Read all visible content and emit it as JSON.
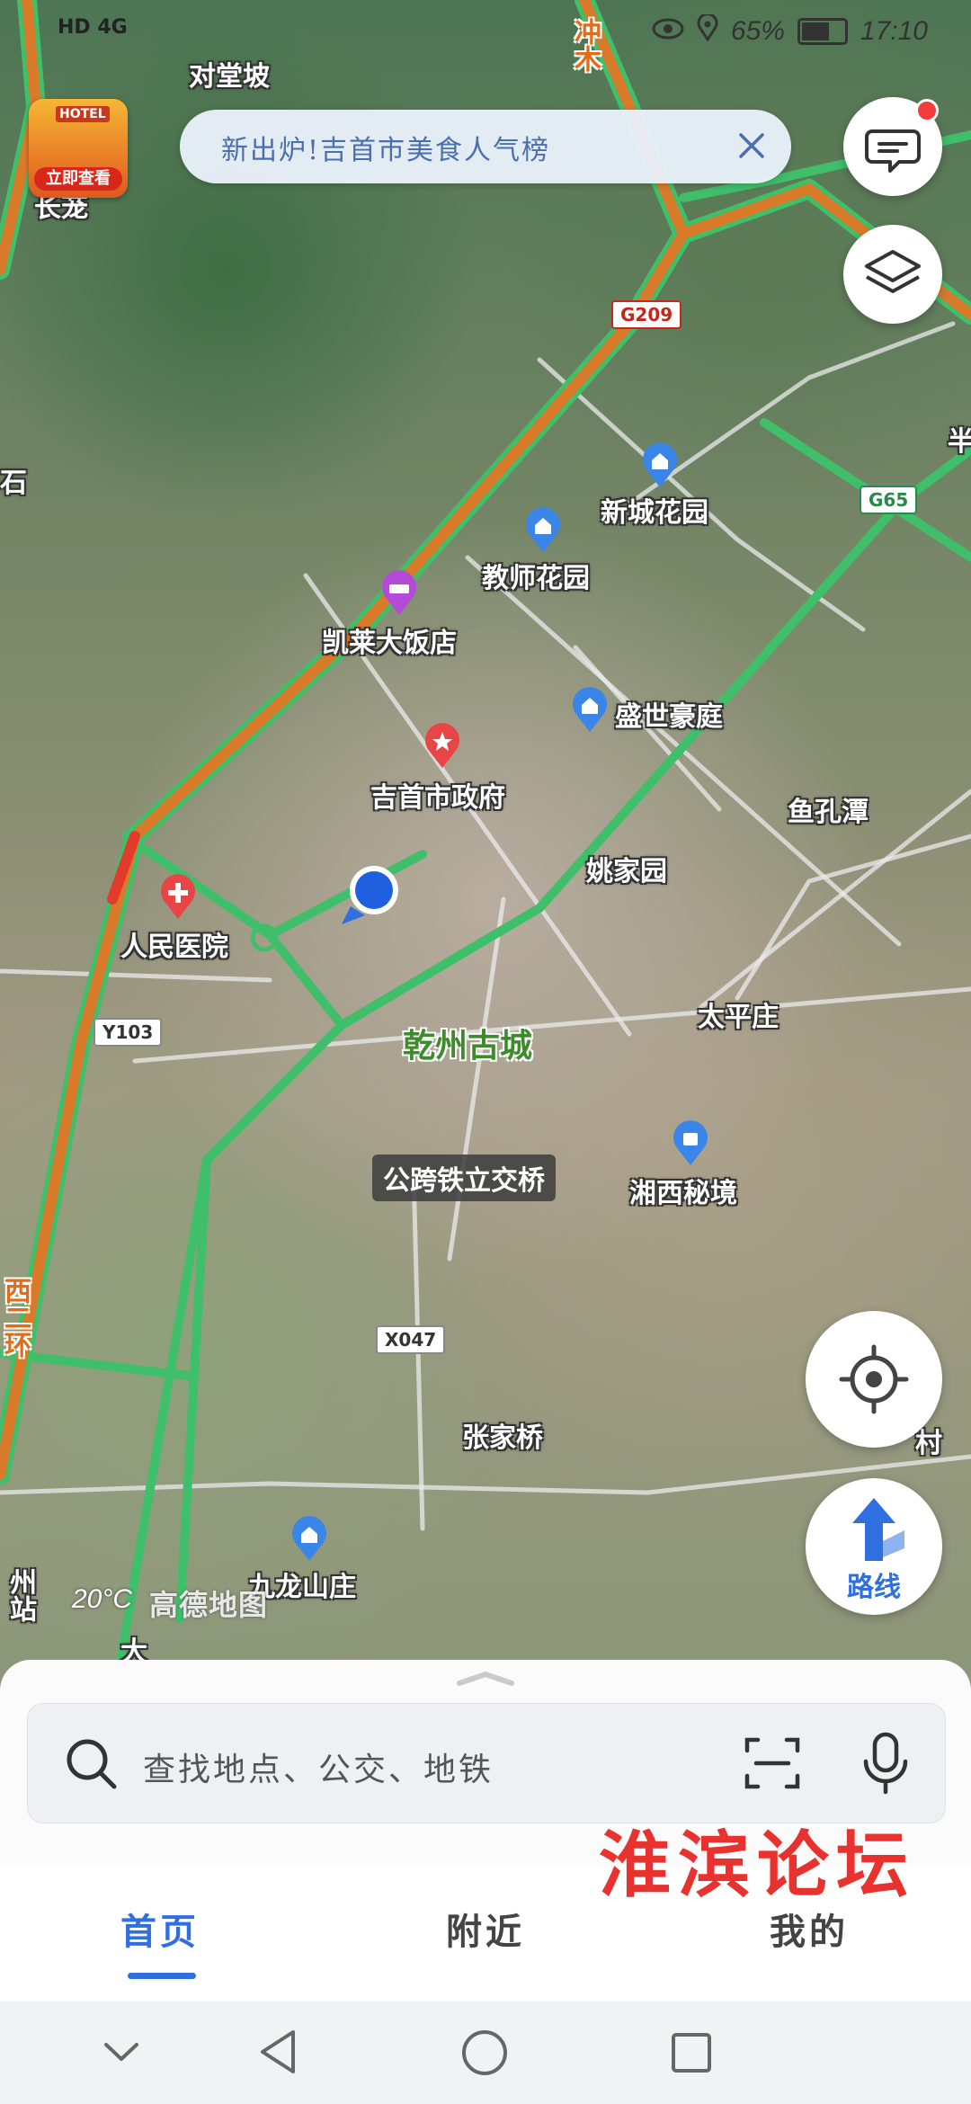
{
  "status_bar": {
    "network": "HD 4G",
    "battery_percent": "65%",
    "time": "17:10"
  },
  "promo": {
    "text": "新出炉!吉首市美食人气榜",
    "close_icon": "close-icon"
  },
  "hotel_badge": {
    "sign": "HOTEL",
    "cta": "立即查看"
  },
  "map": {
    "pois": [
      {
        "id": "xincheng",
        "label": "新城花园",
        "icon": "residential-pin",
        "color": "#3a86e8"
      },
      {
        "id": "jiaoshi",
        "label": "教师花园",
        "icon": "residential-pin",
        "color": "#3a86e8"
      },
      {
        "id": "kailai",
        "label": "凯莱大饭店",
        "icon": "hotel-pin",
        "color": "#b34ad8"
      },
      {
        "id": "shengshi",
        "label": "盛世豪庭",
        "icon": "residential-pin",
        "color": "#3a86e8"
      },
      {
        "id": "zhengfu",
        "label": "吉首市政府",
        "icon": "government-pin",
        "color": "#e84646"
      },
      {
        "id": "hospital",
        "label": "人民医院",
        "icon": "hospital-pin",
        "color": "#e84646"
      },
      {
        "id": "xiangxi",
        "label": "湘西秘境",
        "icon": "scenic-pin",
        "color": "#3a86e8"
      },
      {
        "id": "jiulong",
        "label": "九龙山庄",
        "icon": "residential-pin",
        "color": "#3a86e8"
      }
    ],
    "places": {
      "duitang": "对堂坡",
      "changlong": "长茏",
      "yukongtan": "鱼孔潭",
      "yaojia": "姚家园",
      "taiping": "太平庄",
      "zhangjia": "张家桥",
      "qianzhou": "乾州古城",
      "bridge": "公跨铁立交桥",
      "shi": "石",
      "xi_huan": "西二环",
      "chong": "冲木",
      "ban": "半",
      "zhan": "州站",
      "cun": "村",
      "da": "大"
    },
    "shields": {
      "g209": "G209",
      "g65": "G65",
      "y103": "Y103",
      "x047": "X047"
    },
    "temperature": "20°C",
    "logo": "高德地图"
  },
  "buttons": {
    "message_icon": "message-icon",
    "layers_icon": "layers-icon",
    "locate_icon": "locate-icon",
    "route_label": "路线"
  },
  "search": {
    "placeholder": "查找地点、公交、地铁"
  },
  "tabs": [
    {
      "label": "首页",
      "active": true
    },
    {
      "label": "附近",
      "active": false
    },
    {
      "label": "我的",
      "active": false
    }
  ],
  "watermark": "淮滨论坛",
  "colors": {
    "accent": "#2f6fe0",
    "road_green": "#3fbf6a",
    "highway_orange": "#d97a2b"
  }
}
